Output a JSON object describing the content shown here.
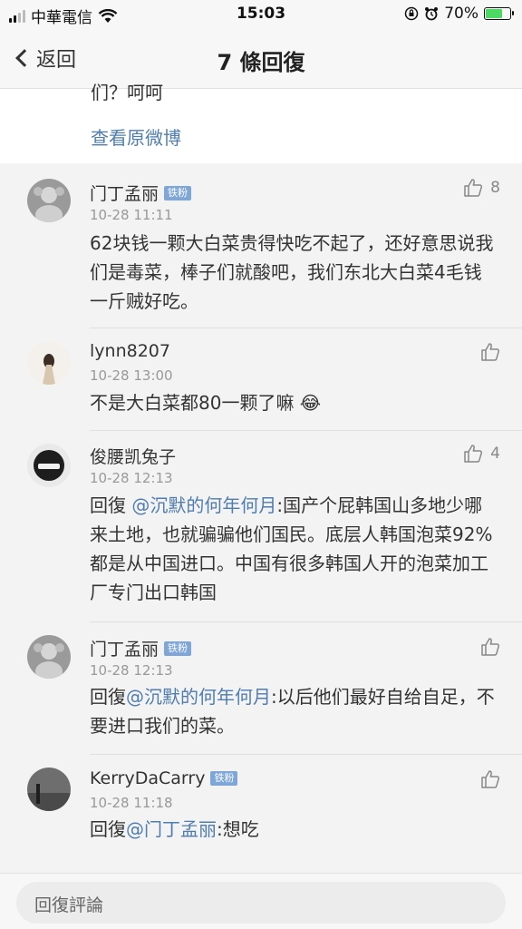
{
  "status_bar": {
    "carrier": "中華電信",
    "time": "15:03",
    "battery": "70%",
    "battery_level": 0.7
  },
  "nav": {
    "back_label": "返回",
    "title": "7 條回復"
  },
  "original": {
    "tail_text": "们？呵呵",
    "view_link": "查看原微博"
  },
  "comments": [
    {
      "name": "门丁孟丽",
      "badge": "铁粉",
      "time": "10-28 11:11",
      "likes": "8",
      "text": "62块钱一颗大白菜贵得快吃不起了，还好意思说我们是毒菜，棒子们就酸吧，我们东北大白菜4毛钱一斤贼好吃。"
    },
    {
      "name": "lynn8207",
      "badge": "",
      "time": "10-28 13:00",
      "likes": "",
      "text": "不是大白菜都80一颗了嘛 😂"
    },
    {
      "name": "俊腰凯兔子",
      "badge": "",
      "time": "10-28 12:13",
      "likes": "4",
      "prefix": "回復 ",
      "mention": "@沉默的何年何月",
      "text": ":国产个屁韩国山多地少哪来土地，也就骗骗他们国民。底层人韩国泡菜92%都是从中国进口。中国有很多韩国人开的泡菜加工厂专门出口韩国"
    },
    {
      "name": "门丁孟丽",
      "badge": "铁粉",
      "time": "10-28 12:13",
      "likes": "",
      "prefix": "回復",
      "mention": "@沉默的何年何月",
      "text": ":以后他们最好自给自足，不要进口我们的菜。"
    },
    {
      "name": "KerryDaCarry",
      "badge": "铁粉",
      "time": "10-28 11:18",
      "likes": "",
      "prefix": "回復",
      "mention": "@门丁孟丽",
      "text": ":想吃"
    }
  ],
  "reply_bar": {
    "placeholder": "回復評論"
  }
}
